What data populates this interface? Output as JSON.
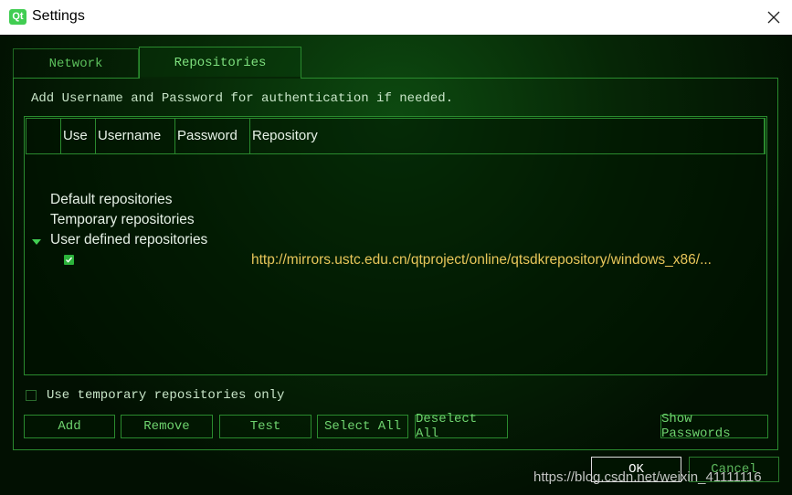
{
  "window": {
    "title": "Settings",
    "app_icon": "Qt"
  },
  "tabs": [
    {
      "label": "Network",
      "active": false
    },
    {
      "label": "Repositories",
      "active": true
    }
  ],
  "hint": "Add Username and Password for authentication if needed.",
  "table": {
    "columns": [
      "",
      "Use",
      "Username",
      "Password",
      "Repository"
    ],
    "groups": [
      {
        "label": "Default repositories"
      },
      {
        "label": "Temporary repositories"
      },
      {
        "label": "User defined repositories",
        "expanded": true
      }
    ],
    "rows": [
      {
        "use_checked": true,
        "username": "",
        "password": "",
        "repository": "http://mirrors.ustc.edu.cn/qtproject/online/qtsdkrepository/windows_x86/..."
      }
    ]
  },
  "temp_only": {
    "label": "Use temporary repositories only",
    "checked": false
  },
  "buttons": {
    "add": "Add",
    "remove": "Remove",
    "test": "Test",
    "select_all": "Select All",
    "deselect_all": "Deselect All",
    "show_passwords": "Show Passwords",
    "ok": "OK",
    "cancel": "Cancel"
  },
  "watermark": "https://blog.csdn.net/weixin_41111116",
  "colors": {
    "accent": "#41cd52",
    "text_green": "#6fd46f",
    "url": "#e8c65a",
    "border": "#2a8a2e"
  }
}
